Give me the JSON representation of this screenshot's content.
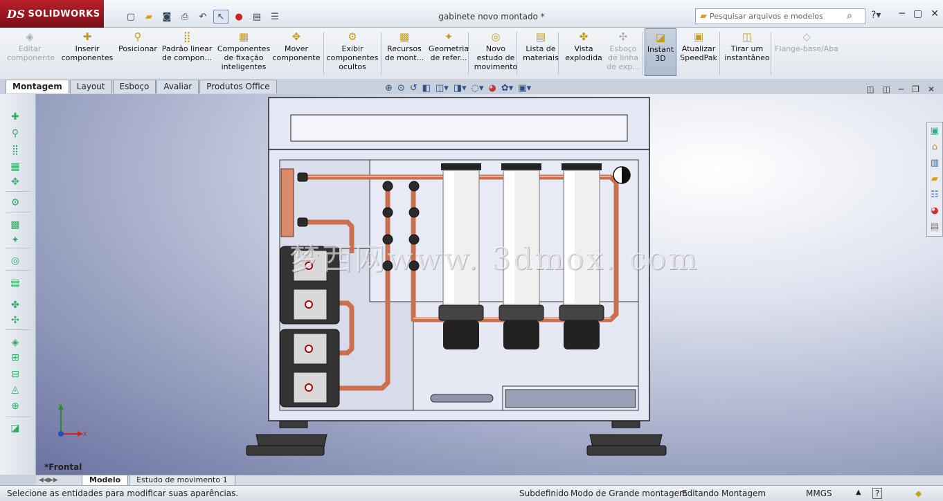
{
  "app": {
    "brand": "SOLIDWORKS",
    "doc_title": "gabinete novo montado *"
  },
  "search": {
    "placeholder": "Pesquisar arquivos e modelos"
  },
  "ribbon": [
    {
      "label": "Editar\ncomponente",
      "icon": "edit-component-icon",
      "enabled": false
    },
    {
      "label": "Inserir\ncomponentes",
      "icon": "insert-components-icon",
      "enabled": true
    },
    {
      "label": "Posicionar",
      "icon": "mate-icon",
      "enabled": true
    },
    {
      "label": "Padrão linear\nde compon...",
      "icon": "linear-pattern-icon",
      "enabled": true
    },
    {
      "label": "Componentes\nde fixação\ninteligentes",
      "icon": "smart-fasteners-icon",
      "enabled": true
    },
    {
      "label": "Mover\ncomponente",
      "icon": "move-component-icon",
      "enabled": true
    },
    {
      "label": "Exibir\ncomponentes\nocultos",
      "icon": "show-hidden-icon",
      "enabled": true
    },
    {
      "label": "Recursos\nde mont...",
      "icon": "assembly-features-icon",
      "enabled": true
    },
    {
      "label": "Geometria\nde refer...",
      "icon": "reference-geometry-icon",
      "enabled": true
    },
    {
      "label": "Novo\nestudo de\nmovimento",
      "icon": "motion-study-icon",
      "enabled": true
    },
    {
      "label": "Lista de\nmateriais",
      "icon": "bom-icon",
      "enabled": true
    },
    {
      "label": "Vista\nexplodida",
      "icon": "exploded-view-icon",
      "enabled": true
    },
    {
      "label": "Esboço\nde linha\nde exp...",
      "icon": "explode-line-sketch-icon",
      "enabled": false
    },
    {
      "label": "Instant\n3D",
      "icon": "instant3d-icon",
      "enabled": true,
      "active": true
    },
    {
      "label": "Atualizar\nSpeedPak",
      "icon": "speedpak-icon",
      "enabled": true
    },
    {
      "label": "Tirar um\ninstantâneo",
      "icon": "snapshot-icon",
      "enabled": true
    },
    {
      "label": "Flange-base/Aba",
      "icon": "base-flange-icon",
      "enabled": false
    }
  ],
  "tabs": [
    "Montagem",
    "Layout",
    "Esboço",
    "Avaliar",
    "Produtos Office"
  ],
  "active_tab": "Montagem",
  "view": {
    "name": "*Frontal",
    "watermark": "梦西网www. 3dmox. com"
  },
  "bottom_tabs": [
    "Modelo",
    "Estudo de movimento 1"
  ],
  "status": {
    "message": "Selecione as entidades para modificar suas aparências.",
    "definition": "Subdefinido",
    "mode": "Modo de Grande montagem",
    "editing": "Editando Montagem",
    "units": "MMGS"
  },
  "colors": {
    "accent": "#b8202a",
    "pipe": "#d98a6a",
    "cabinet": "#dfe3f2"
  }
}
